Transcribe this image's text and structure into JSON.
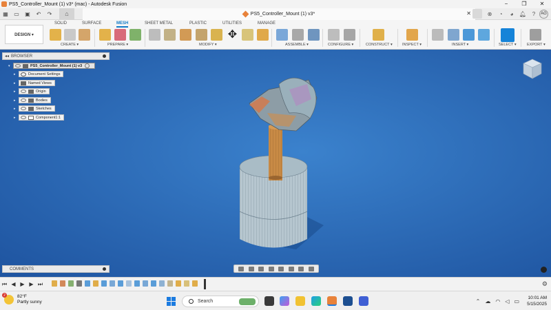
{
  "window": {
    "title": "PS5_Controller_Mount (1) v3* (mac) - Autodesk Fusion",
    "minimize": "−",
    "maximize": "❐",
    "close": "✕"
  },
  "quick_access": {
    "grid_icon": "apps-grid-icon",
    "document_title": "PS5_Controller_Mount (1) v3*",
    "tab_close": "✕",
    "avatar_initials": "AG"
  },
  "ribbon": {
    "design_label": "DESIGN ▾",
    "tabs": [
      "SOLID",
      "SURFACE",
      "MESH",
      "SHEET METAL",
      "PLASTIC",
      "UTILITIES",
      "MANAGE"
    ],
    "active_tab": "MESH",
    "groups": [
      "CREATE ▾",
      "PREPARE ▾",
      "MODIFY ▾",
      "ASSEMBLE ▾",
      "CONFIGURE ▾",
      "CONSTRUCT ▾",
      "INSPECT ▾",
      "INSERT ▾",
      "SELECT ▾",
      "EXPORT ▾"
    ]
  },
  "browser": {
    "header": "BROWSER",
    "root": "PS5_Controller_Mount (1) v3",
    "items": [
      "Document Settings",
      "Named Views",
      "Origin",
      "Bodies",
      "Sketches",
      "Component1:1"
    ]
  },
  "comments": {
    "header": "COMMENTS"
  },
  "timeline": {
    "controls": [
      "⏮",
      "◀",
      "▶",
      "▶",
      "⏭"
    ],
    "settings_icon": "gear-icon"
  },
  "taskbar": {
    "weather_temp": "82°F",
    "weather_desc": "Partly sunny",
    "weather_badge": "2",
    "search_label": "Search",
    "time": "10:01 AM",
    "date": "5/15/2025"
  },
  "colors": {
    "viewport_bg": "#2d6cb4",
    "accent": "#0f7ac7",
    "mesh_body": "#b6c6cf",
    "mesh_shaft": "#c88a45"
  }
}
